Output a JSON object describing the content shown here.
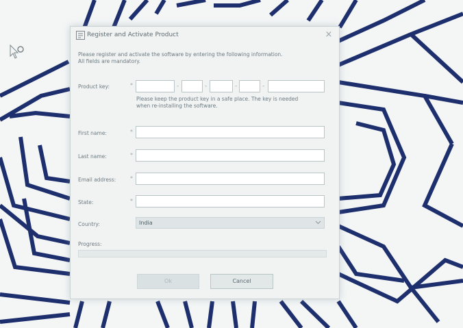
{
  "dialog": {
    "title": "Register and Activate Product",
    "close_glyph": "×",
    "intro": "Please register and activate the software by entering the following information.",
    "intro_line2": "All fields are mandatory.",
    "required_marker": "*",
    "product_key": {
      "label": "Product key:",
      "segments": [
        "",
        "",
        "",
        "",
        ""
      ],
      "separator": "-",
      "note_line1": "Please keep the product key in a safe place. The key is needed",
      "note_line2": "when re-installing the software."
    },
    "fields": {
      "first_name": {
        "label": "First name:",
        "value": ""
      },
      "last_name": {
        "label": "Last name:",
        "value": ""
      },
      "email": {
        "label": "Email address:",
        "value": ""
      },
      "state": {
        "label": "State:",
        "value": ""
      }
    },
    "country": {
      "label": "Country:",
      "value": "India"
    },
    "progress": {
      "label": "Progress:",
      "fraction": 0
    },
    "buttons": {
      "ok": "Ok",
      "cancel": "Cancel"
    }
  },
  "icons": {
    "cursor": "pointer-busy-icon",
    "app": "app-icon",
    "chevron": "chevron-down-icon"
  }
}
